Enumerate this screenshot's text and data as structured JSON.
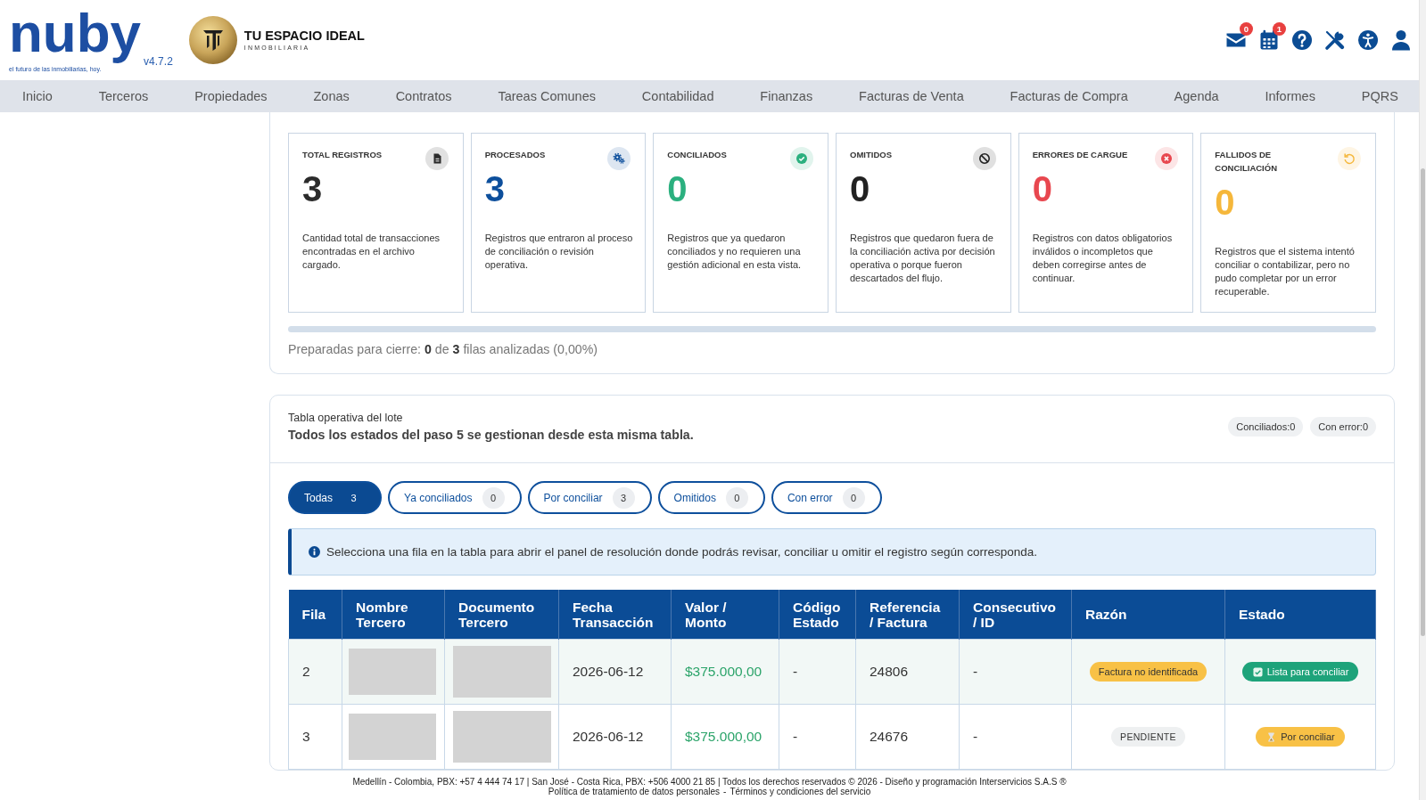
{
  "header": {
    "brand": {
      "name": "nuby",
      "tagline": "el futuro de las inmobiliarias, hoy.",
      "version": "v4.7.2"
    },
    "company": {
      "name": "TU ESPACIO IDEAL",
      "subtitle": "INMOBILIARIA"
    },
    "mail_badge": "0",
    "calendar_badge": "1"
  },
  "nav": [
    "Inicio",
    "Terceros",
    "Propiedades",
    "Zonas",
    "Contratos",
    "Tareas Comunes",
    "Contabilidad",
    "Finanzas",
    "Facturas de Venta",
    "Facturas de Compra",
    "Agenda",
    "Informes",
    "PQRS"
  ],
  "summary": {
    "cards": [
      {
        "title": "TOTAL REGISTROS",
        "value": "3",
        "description": "Cantidad total de transacciones encontradas en el archivo cargado.",
        "color": "#2b2b2b"
      },
      {
        "title": "PROCESADOS",
        "value": "3",
        "description": "Registros que entraron al proceso de conciliación o revisión operativa.",
        "color": "#0d4f9c"
      },
      {
        "title": "CONCILIADOS",
        "value": "0",
        "description": "Registros que ya quedaron conciliados y no requieren una gestión adicional en esta vista.",
        "color": "#2bb07f"
      },
      {
        "title": "OMITIDOS",
        "value": "0",
        "description": "Registros que quedaron fuera de la conciliación activa por decisión operativa o porque fueron descartados del flujo.",
        "color": "#222222"
      },
      {
        "title": "ERRORES DE CARGUE",
        "value": "0",
        "description": "Registros con datos obligatorios inválidos o incompletos que deben corregirse antes de continuar.",
        "color": "#e8474f"
      },
      {
        "title": "FALLIDOS DE CONCILIACIÓN",
        "value": "0",
        "description": "Registros que el sistema intentó conciliar o contabilizar, pero no pudo completar por un error recuperable.",
        "color": "#f5b73b"
      }
    ],
    "progress": {
      "level": 0,
      "caption": "Preparadas para cierre: **0** de **3** filas analizadas (0,00%)"
    }
  },
  "operations": {
    "title": "Tabla operativa del lote",
    "subtitle": "Todos los estados del paso 5 se gestionan desde esta misma tabla.",
    "badges": [
      "Conciliados:0",
      "Con error:0"
    ],
    "filters": [
      {
        "label": "Todas",
        "count": "3",
        "selected": true
      },
      {
        "label": "Ya conciliados",
        "count": "0",
        "selected": false
      },
      {
        "label": "Por conciliar",
        "count": "3",
        "selected": false
      },
      {
        "label": "Omitidos",
        "count": "0",
        "selected": false
      },
      {
        "label": "Con error",
        "count": "0",
        "selected": false
      }
    ],
    "info": "Selecciona una fila en la tabla para abrir el panel de resolución donde podrás revisar, conciliar u omitir el registro según corresponda.",
    "table": {
      "columns": [
        "Fila",
        "Nombre Tercero",
        "Documento Tercero",
        "Fecha Transacción",
        "Valor / Monto",
        "Código Estado",
        "Referencia / Factura",
        "Consecutivo / ID",
        "Razón",
        "Estado"
      ],
      "rows": [
        {
          "fila": "2",
          "highlighted": true,
          "nombre_tercero_redacted": true,
          "documento_tercero_redacted": true,
          "fecha_transaccion": "2026-06-12",
          "valor_monto": "$375.000,00",
          "codigo_estado": "-",
          "referencia_factura": "24806",
          "consecutivo_id": "-",
          "razon": {
            "label": "Factura no identificada",
            "kind": "warning"
          },
          "estado": {
            "label": "Lista para conciliar",
            "kind": "ready"
          }
        },
        {
          "fila": "3",
          "highlighted": false,
          "nombre_tercero_redacted": true,
          "documento_tercero_redacted": true,
          "fecha_transaccion": "2026-06-12",
          "valor_monto": "$375.000,00",
          "codigo_estado": "-",
          "referencia_factura": "24676",
          "consecutivo_id": "-",
          "razon": {
            "label": "PENDIENTE",
            "kind": "neutral"
          },
          "estado": {
            "label": "Por conciliar",
            "kind": "pending"
          }
        }
      ]
    }
  },
  "footer": {
    "address_line": "Medellín - Colombia, PBX: +57 4 444 74 17 | San José - Costa Rica, PBX: +506 4000 21 85 | Todos los derechos reservados © 2026 - Diseño y programación Interservicios S.A.S ®",
    "links": [
      "Política de tratamiento de datos personales",
      "Términos y condiciones del servicio"
    ],
    "link_separator": "-"
  }
}
